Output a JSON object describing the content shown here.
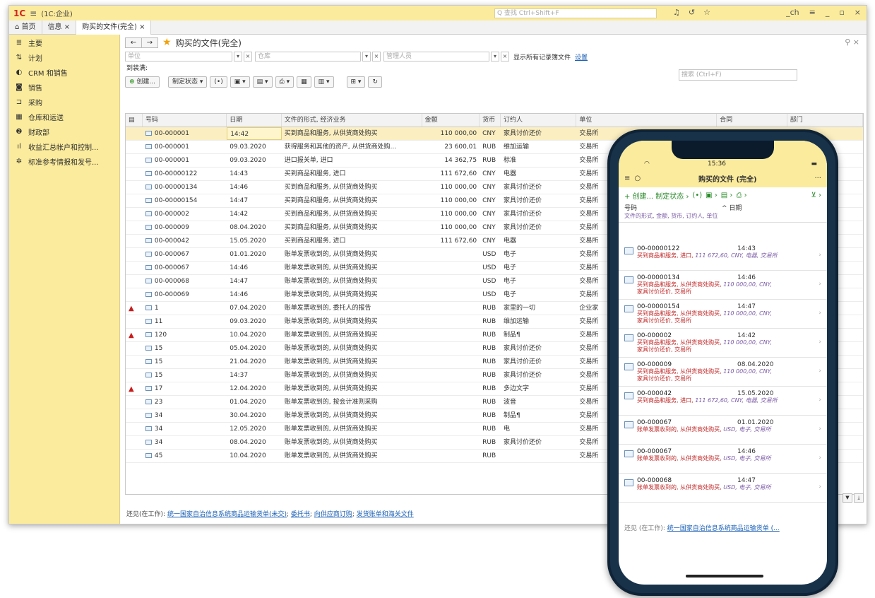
{
  "titlebar": {
    "app": "(1C:企业)",
    "search": "Q 查找 Ctrl+Shift+F",
    "right": "_ch"
  },
  "tabs": [
    "首页",
    "信息 ×",
    "购买的文件(完全) ×"
  ],
  "sidebar": [
    {
      "icon": "menu-icon",
      "label": "主要"
    },
    {
      "icon": "plan-icon",
      "label": "计划"
    },
    {
      "icon": "crm-icon",
      "label": "CRM 和销售"
    },
    {
      "icon": "sales-icon",
      "label": "销售"
    },
    {
      "icon": "cart-icon",
      "label": "采购"
    },
    {
      "icon": "warehouse-icon",
      "label": "仓库和运送"
    },
    {
      "icon": "finance-icon",
      "label": "财政部"
    },
    {
      "icon": "report-icon",
      "label": "收益汇总帐户和控制..."
    },
    {
      "icon": "gear-icon",
      "label": "标准参考情报和发号..."
    }
  ],
  "form": {
    "title": "购买的文件(完全)",
    "filter_unit": "单位",
    "filter_warehouse": "仓库",
    "filter_manager": "管理人员",
    "show_all": "显示所有记录簿文件",
    "settings": "设置",
    "subtitle": "到装满:",
    "create": "创建...",
    "status_btn": "制定状态 ▾",
    "search": "搜索 (Ctrl+F)"
  },
  "columns": [
    "号码",
    "日期",
    "文件的形式, 经济业务",
    "金额",
    "货币",
    "订约人",
    "单位",
    "合同",
    "部门"
  ],
  "rows": [
    {
      "warn": "",
      "num": "00-000001",
      "date": "14:42",
      "form": "买到商品和服务, 从供货商处购买",
      "amt": "110 000,00",
      "cur": "CNY",
      "party": "家具讨价还价",
      "unit": "交易所"
    },
    {
      "warn": "",
      "num": "00-000001",
      "date": "09.03.2020",
      "form": "获得服务和其他的资产, 从供货商处购...",
      "amt": "23 600,01",
      "cur": "RUB",
      "party": "维加运输",
      "unit": "交易所"
    },
    {
      "warn": "",
      "num": "00-000001",
      "date": "09.03.2020",
      "form": "进口报关单, 进口",
      "amt": "14 362,75",
      "cur": "RUB",
      "party": "标准",
      "unit": "交易所"
    },
    {
      "warn": "",
      "num": "00-00000122",
      "date": "14:43",
      "form": "买到商品和服务, 进口",
      "amt": "111 672,60",
      "cur": "CNY",
      "party": "电器",
      "unit": "交易所"
    },
    {
      "warn": "",
      "num": "00-00000134",
      "date": "14:46",
      "form": "买到商品和服务, 从供货商处购买",
      "amt": "110 000,00",
      "cur": "CNY",
      "party": "家具讨价还价",
      "unit": "交易所"
    },
    {
      "warn": "",
      "num": "00-00000154",
      "date": "14:47",
      "form": "买到商品和服务, 从供货商处购买",
      "amt": "110 000,00",
      "cur": "CNY",
      "party": "家具讨价还价",
      "unit": "交易所"
    },
    {
      "warn": "",
      "num": "00-000002",
      "date": "14:42",
      "form": "买到商品和服务, 从供货商处购买",
      "amt": "110 000,00",
      "cur": "CNY",
      "party": "家具讨价还价",
      "unit": "交易所"
    },
    {
      "warn": "",
      "num": "00-000009",
      "date": "08.04.2020",
      "form": "买到商品和服务, 从供货商处购买",
      "amt": "110 000,00",
      "cur": "CNY",
      "party": "家具讨价还价",
      "unit": "交易所"
    },
    {
      "warn": "",
      "num": "00-000042",
      "date": "15.05.2020",
      "form": "买到商品和服务, 进口",
      "amt": "111 672,60",
      "cur": "CNY",
      "party": "电器",
      "unit": "交易所"
    },
    {
      "warn": "",
      "num": "00-000067",
      "date": "01.01.2020",
      "form": "账单发票收到的, 从供货商处购买",
      "amt": "",
      "cur": "USD",
      "party": "电子",
      "unit": "交易所"
    },
    {
      "warn": "",
      "num": "00-000067",
      "date": "14:46",
      "form": "账单发票收到的, 从供货商处购买",
      "amt": "",
      "cur": "USD",
      "party": "电子",
      "unit": "交易所"
    },
    {
      "warn": "",
      "num": "00-000068",
      "date": "14:47",
      "form": "账单发票收到的, 从供货商处购买",
      "amt": "",
      "cur": "USD",
      "party": "电子",
      "unit": "交易所"
    },
    {
      "warn": "",
      "num": "00-000069",
      "date": "14:46",
      "form": "账单发票收到的, 从供货商处购买",
      "amt": "",
      "cur": "USD",
      "party": "电子",
      "unit": "交易所"
    },
    {
      "warn": "▲",
      "num": "1",
      "date": "07.04.2020",
      "form": "账单发票收到的, 委托人的报告",
      "amt": "",
      "cur": "RUB",
      "party": "家里的一切",
      "unit": "企业家"
    },
    {
      "warn": "",
      "num": "11",
      "date": "09.03.2020",
      "form": "账单发票收到的, 从供货商处购买",
      "amt": "",
      "cur": "RUB",
      "party": "维加运输",
      "unit": "交易所"
    },
    {
      "warn": "▲",
      "num": "120",
      "date": "10.04.2020",
      "form": "账单发票收到的, 从供货商处购买",
      "amt": "",
      "cur": "RUB",
      "party": "制品¶",
      "unit": "交易所"
    },
    {
      "warn": "",
      "num": "15",
      "date": "05.04.2020",
      "form": "账单发票收到的, 从供货商处购买",
      "amt": "",
      "cur": "RUB",
      "party": "家具讨价还价",
      "unit": "交易所"
    },
    {
      "warn": "",
      "num": "15",
      "date": "21.04.2020",
      "form": "账单发票收到的, 从供货商处购买",
      "amt": "",
      "cur": "RUB",
      "party": "家具讨价还价",
      "unit": "交易所"
    },
    {
      "warn": "",
      "num": "15",
      "date": "14:37",
      "form": "账单发票收到的, 从供货商处购买",
      "amt": "",
      "cur": "RUB",
      "party": "家具讨价还价",
      "unit": "交易所"
    },
    {
      "warn": "▲",
      "num": "17",
      "date": "12.04.2020",
      "form": "账单发票收到的, 从供货商处购买",
      "amt": "",
      "cur": "RUB",
      "party": "多边文字",
      "unit": "交易所"
    },
    {
      "warn": "",
      "num": "23",
      "date": "01.04.2020",
      "form": "账单发票收到的, 按会计准则采购",
      "amt": "",
      "cur": "RUB",
      "party": "波音",
      "unit": "交易所"
    },
    {
      "warn": "",
      "num": "34",
      "date": "30.04.2020",
      "form": "账单发票收到的, 从供货商处购买",
      "amt": "",
      "cur": "RUB",
      "party": "制品¶",
      "unit": "交易所"
    },
    {
      "warn": "",
      "num": "34",
      "date": "12.05.2020",
      "form": "账单发票收到的, 从供货商处购买",
      "amt": "",
      "cur": "RUB",
      "party": "电",
      "unit": "交易所"
    },
    {
      "warn": "",
      "num": "34",
      "date": "08.04.2020",
      "form": "账单发票收到的, 从供货商处购买",
      "amt": "",
      "cur": "RUB",
      "party": "家具讨价还价",
      "unit": "交易所"
    },
    {
      "warn": "",
      "num": "45",
      "date": "10.04.2020",
      "form": "账单发票收到的, 从供货商处购买",
      "amt": "",
      "cur": "RUB",
      "party": "",
      "unit": "交易所"
    }
  ],
  "footer": {
    "prefix": "还见(在工作):",
    "l1": "统一国家自治信息系统商品运输货单(未交)",
    "l2": "委托书",
    "l3": "向供应商订购",
    "l4": "发货账单和海关文件"
  },
  "phone": {
    "time": "15:36",
    "title": "购买的文件 (完全)",
    "toolbar": "+ 创建... 制定状态 ›",
    "col1": "号码",
    "col2": "日期",
    "colsub": "文件的形式, 金额, 货币, 订约人, 单位",
    "items": [
      {
        "n": "00-00000122",
        "d": "14:43",
        "desc": "买到商品和服务, 进口,",
        "it": "111 672,60, CNY, 电器, 交易所",
        "desc2": ""
      },
      {
        "n": "00-00000134",
        "d": "14:46",
        "desc": "买到商品和服务, 从供货商处购买,",
        "it": "110 000,00, CNY,",
        "desc2": "家具讨价还价, 交易所"
      },
      {
        "n": "00-00000154",
        "d": "14:47",
        "desc": "买到商品和服务, 从供货商处购买,",
        "it": "110 000,00, CNY,",
        "desc2": "家具讨价还价, 交易所"
      },
      {
        "n": "00-000002",
        "d": "14:42",
        "desc": "买到商品和服务, 从供货商处购买,",
        "it": "110 000,00, CNY,",
        "desc2": "家具讨价还价, 交易所"
      },
      {
        "n": "00-000009",
        "d": "08.04.2020",
        "desc": "买到商品和服务, 从供货商处购买,",
        "it": "110 000,00, CNY,",
        "desc2": "家具讨价还价, 交易所"
      },
      {
        "n": "00-000042",
        "d": "15.05.2020",
        "desc": "买到商品和服务, 进口,",
        "it": "111 672,60, CNY, 电器, 交易所",
        "desc2": ""
      },
      {
        "n": "00-000067",
        "d": "01.01.2020",
        "desc": "账单发票收到的, 从供货商处购买,",
        "it": "USD, 电子, 交易所",
        "desc2": ""
      },
      {
        "n": "00-000067",
        "d": "14:46",
        "desc": "账单发票收到的, 从供货商处购买,",
        "it": "USD, 电子, 交易所",
        "desc2": ""
      },
      {
        "n": "00-000068",
        "d": "14:47",
        "desc": "账单发票收到的, 从供货商处购买,",
        "it": "USD, 电子, 交易所",
        "desc2": ""
      }
    ],
    "footer_prefix": "还见 (在工作):",
    "footer_link": "统一国家自治信息系统商品运输货单 (..."
  }
}
